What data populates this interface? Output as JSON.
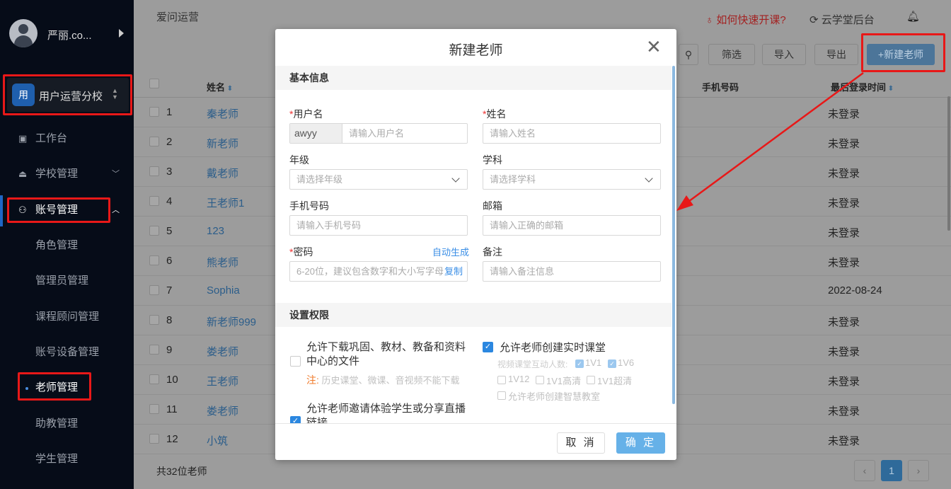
{
  "sidebar": {
    "user_name": "严丽.co...",
    "school_badge": "用",
    "school_name": "用户运营分校",
    "items": [
      {
        "label": "工作台"
      },
      {
        "label": "学校管理"
      },
      {
        "label": "账号管理"
      }
    ],
    "subitems": [
      {
        "label": "角色管理"
      },
      {
        "label": "管理员管理"
      },
      {
        "label": "课程顾问管理"
      },
      {
        "label": "账号设备管理"
      },
      {
        "label": "老师管理"
      },
      {
        "label": "助教管理"
      },
      {
        "label": "学生管理"
      }
    ]
  },
  "header": {
    "breadcrumb": "爱问运营",
    "help": "如何快速开课?",
    "yun": "云学堂后台"
  },
  "toolbar": {
    "filter": "筛选",
    "import": "导入",
    "export": "导出",
    "new_teacher": "+新建老师"
  },
  "table": {
    "headers": {
      "name": "姓名",
      "phone": "手机号码",
      "last_login": "最后登录时间"
    },
    "rows": [
      {
        "i": "1",
        "n": "秦老师",
        "l": "未登录"
      },
      {
        "i": "2",
        "n": "新老师",
        "l": "未登录"
      },
      {
        "i": "3",
        "n": "戴老师",
        "l": "未登录"
      },
      {
        "i": "4",
        "n": "王老师1",
        "l": "未登录"
      },
      {
        "i": "5",
        "n": "123",
        "l": "未登录"
      },
      {
        "i": "6",
        "n": "熊老师",
        "l": "未登录"
      },
      {
        "i": "7",
        "n": "Sophia",
        "l": "2022-08-24"
      },
      {
        "i": "8",
        "n": "新老师999",
        "l": "未登录"
      },
      {
        "i": "9",
        "n": "娄老师",
        "l": "未登录"
      },
      {
        "i": "10",
        "n": "王老师",
        "l": "未登录"
      },
      {
        "i": "11",
        "n": "娄老师",
        "l": "未登录"
      },
      {
        "i": "12",
        "n": "小筑",
        "l": "未登录"
      }
    ],
    "total": "共32位老师",
    "page": "1"
  },
  "modal": {
    "title": "新建老师",
    "section_basic": "基本信息",
    "section_perm": "设置权限",
    "username_label": "用户名",
    "username_prefix": "awyy",
    "username_ph": "请输入用户名",
    "name_label": "姓名",
    "name_ph": "请输入姓名",
    "grade_label": "年级",
    "grade_ph": "请选择年级",
    "subject_label": "学科",
    "subject_ph": "请选择学科",
    "phone_label": "手机号码",
    "phone_ph": "请输入手机号码",
    "email_label": "邮箱",
    "email_ph": "请输入正确的邮箱",
    "pwd_label": "密码",
    "pwd_auto": "自动生成",
    "pwd_ph": "6-20位，建议包含数字和大小写字母",
    "pwd_copy": "复制",
    "note_label": "备注",
    "note_ph": "请输入备注信息",
    "perm_download": "允许下载巩固、教材、教备和资料中心的文件",
    "perm_note_prefix": "注:",
    "perm_note": "历史课堂、微课、音视频不能下载",
    "perm_invite": "允许老师邀请体验学生或分享直播链接",
    "perm_live": "允许老师创建实时课堂",
    "perm_count_label": "视频课堂互动人数:",
    "opt_1v1": "1V1",
    "opt_1v6": "1V6",
    "opt_1v12": "1V12",
    "opt_1v1hd": "1V1高清",
    "opt_1v1uhd": "1V1超清",
    "opt_smart": "允许老师创建智慧教室",
    "cancel": "取 消",
    "ok": "确 定"
  },
  "colors": {
    "accent": "#2b87e0",
    "annotation": "#e81818"
  }
}
